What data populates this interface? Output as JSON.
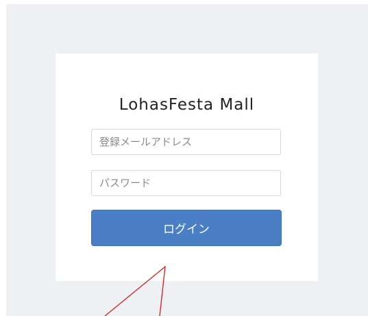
{
  "login": {
    "brand_title": "LohasFesta Mall",
    "email_placeholder": "登録メールアドレス",
    "password_placeholder": "パスワード",
    "login_button_label": "ログイン"
  },
  "colors": {
    "page_background": "#eef0f3",
    "card_background": "#ffffff",
    "button_background": "#4a7fc6",
    "annotation_arrow": "#d22a2a"
  },
  "annotation": {
    "icon": "red-arrow-annotation"
  }
}
